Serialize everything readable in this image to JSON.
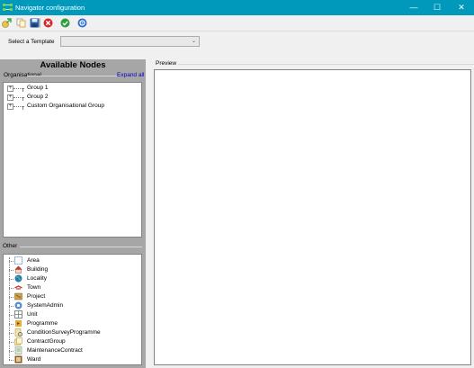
{
  "window": {
    "title": "Navigator configuration",
    "minimize_glyph": "—",
    "maximize_glyph": "☐",
    "close_glyph": "✕"
  },
  "toolbar": {
    "icons": [
      "new-icon",
      "copy-icon",
      "save-icon",
      "delete-icon",
      "confirm-icon",
      "settings-icon"
    ]
  },
  "template": {
    "label": "Select a Template",
    "value": "",
    "arrow": "⌄"
  },
  "available_nodes": {
    "title": "Available Nodes",
    "organisational_label": "Organisational",
    "expand_all": "Expand all",
    "expander": "+",
    "org_items": [
      "Group 1",
      "Group 2",
      "Custom Organisational Group"
    ],
    "other_label": "Other",
    "other_items": [
      {
        "label": "Area",
        "icon": "area-icon"
      },
      {
        "label": "Building",
        "icon": "building-icon"
      },
      {
        "label": "Locality",
        "icon": "locality-icon"
      },
      {
        "label": "Town",
        "icon": "town-icon"
      },
      {
        "label": "Project",
        "icon": "project-icon"
      },
      {
        "label": "SystemAdmin",
        "icon": "system-admin-icon"
      },
      {
        "label": "Unit",
        "icon": "unit-icon"
      },
      {
        "label": "Programme",
        "icon": "programme-icon"
      },
      {
        "label": "ConditionSurveyProgramme",
        "icon": "condition-survey-icon"
      },
      {
        "label": "ContractGroup",
        "icon": "contract-group-icon"
      },
      {
        "label": "MaintenanceContract",
        "icon": "maintenance-contract-icon"
      },
      {
        "label": "Ward",
        "icon": "ward-icon"
      }
    ]
  },
  "preview": {
    "label": "Preview"
  },
  "colors": {
    "titlebar": "#0099bc",
    "panel": "#a6a6a6",
    "link": "#0000cc"
  }
}
